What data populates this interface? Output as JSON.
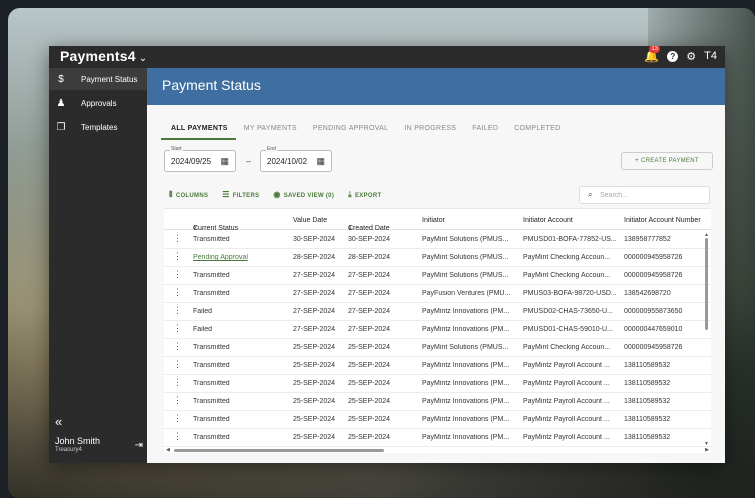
{
  "app": {
    "brand": "Payments4",
    "brand_chevron": "⌄",
    "notification_count": "13",
    "help_icon": "?",
    "settings_icon": "⚙",
    "workspace": "T4"
  },
  "sidebar": {
    "items": [
      {
        "label": "Payment Status",
        "icon": "dollar-circle-icon",
        "glyph": "$",
        "active": true
      },
      {
        "label": "Approvals",
        "icon": "person-icon",
        "glyph": "♟",
        "active": false
      },
      {
        "label": "Templates",
        "icon": "copy-icon",
        "glyph": "❐",
        "active": false
      }
    ],
    "collapse_glyph": "«",
    "user": {
      "name": "John Smith",
      "org": "Treasury4",
      "logout_glyph": "⇥"
    }
  },
  "page": {
    "title": "Payment Status"
  },
  "tabs": [
    "ALL PAYMENTS",
    "MY PAYMENTS",
    "PENDING APPROVAL",
    "IN PROGRESS",
    "FAILED",
    "COMPLETED"
  ],
  "filters": {
    "start_label": "Start",
    "start_value": "2024/09/25",
    "end_label": "End",
    "end_value": "2024/10/02",
    "separator": "–",
    "create_button": "+ CREATE PAYMENT"
  },
  "toolbar": {
    "columns": "COLUMNS",
    "filters": "FILTERS",
    "saved_view": "SAVED VIEW (0)",
    "export": "EXPORT",
    "search_placeholder": "Search..."
  },
  "table": {
    "headers": {
      "status": "Current Status",
      "status_sort": "↑",
      "status_rank": "2",
      "value_date": "Value Date",
      "created_date": "Created Date",
      "created_sort": "↓",
      "created_rank": "1",
      "initiator": "Initiator",
      "initiator_account": "Initiator Account",
      "initiator_account_number": "Initiator Account Number"
    },
    "rows": [
      {
        "status": "Transmitted",
        "value_date": "30-SEP-2024",
        "created_date": "30-SEP-2024",
        "initiator": "PayMint Solutions (PMUS...",
        "account": "PMUSD01-BOFA-77852-US...",
        "number": "138958777852"
      },
      {
        "status": "Pending Approval",
        "value_date": "28-SEP-2024",
        "created_date": "28-SEP-2024",
        "initiator": "PayMint Solutions (PMUS...",
        "account": "PayMint Checking Accoun...",
        "number": "000000945958726"
      },
      {
        "status": "Transmitted",
        "value_date": "27-SEP-2024",
        "created_date": "27-SEP-2024",
        "initiator": "PayMint Solutions (PMUS...",
        "account": "PayMint Checking Accoun...",
        "number": "000000945958726"
      },
      {
        "status": "Transmitted",
        "value_date": "27-SEP-2024",
        "created_date": "27-SEP-2024",
        "initiator": "PayFusion Ventures (PMU...",
        "account": "PMUS03-BOFA-98720-USD...",
        "number": "138542698720"
      },
      {
        "status": "Failed",
        "value_date": "27-SEP-2024",
        "created_date": "27-SEP-2024",
        "initiator": "PayMintz Innovations (PM...",
        "account": "PMUSD02-CHAS-73650-U...",
        "number": "000000955873650"
      },
      {
        "status": "Failed",
        "value_date": "27-SEP-2024",
        "created_date": "27-SEP-2024",
        "initiator": "PayMintz Innovations (PM...",
        "account": "PMUSD01-CHAS-59010-U...",
        "number": "000000447659010"
      },
      {
        "status": "Transmitted",
        "value_date": "25-SEP-2024",
        "created_date": "25-SEP-2024",
        "initiator": "PayMint Solutions (PMUS...",
        "account": "PayMint Checking Accoun...",
        "number": "000000945958726"
      },
      {
        "status": "Transmitted",
        "value_date": "25-SEP-2024",
        "created_date": "25-SEP-2024",
        "initiator": "PayMintz Innovations (PM...",
        "account": "PayMintz Payroll Account ...",
        "number": "138110589532"
      },
      {
        "status": "Transmitted",
        "value_date": "25-SEP-2024",
        "created_date": "25-SEP-2024",
        "initiator": "PayMintz Innovations (PM...",
        "account": "PayMintz Payroll Account ...",
        "number": "138110589532"
      },
      {
        "status": "Transmitted",
        "value_date": "25-SEP-2024",
        "created_date": "25-SEP-2024",
        "initiator": "PayMintz Innovations (PM...",
        "account": "PayMintz Payroll Account ...",
        "number": "138110589532"
      },
      {
        "status": "Transmitted",
        "value_date": "25-SEP-2024",
        "created_date": "25-SEP-2024",
        "initiator": "PayMintz Innovations (PM...",
        "account": "PayMintz Payroll Account ...",
        "number": "138110589532"
      },
      {
        "status": "Transmitted",
        "value_date": "25-SEP-2024",
        "created_date": "25-SEP-2024",
        "initiator": "PayMintz Innovations (PM...",
        "account": "PayMintz Payroll Account ...",
        "number": "138110589532"
      }
    ]
  },
  "colors": {
    "accent_green": "#4a7a3a",
    "header_blue": "#3f6ea1",
    "sidebar_dark": "#2b2b2b"
  }
}
